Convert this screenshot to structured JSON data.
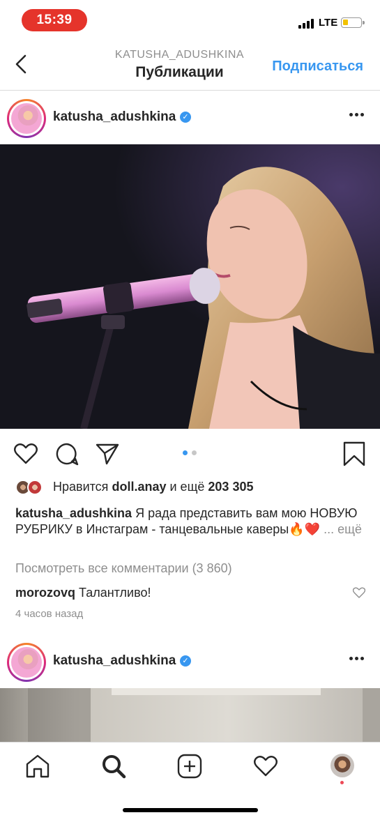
{
  "status_bar": {
    "time": "15:39",
    "network": "LTE",
    "battery_level": 0.3,
    "battery_color": "#f2c200",
    "time_pill_color": "#e5342b"
  },
  "nav": {
    "back_icon": "chevron-left-icon",
    "subtitle": "KATUSHA_ADUSHKINA",
    "title": "Публикации",
    "follow_label": "Подписаться",
    "accent_color": "#3897f0"
  },
  "post": {
    "username": "katusha_adushkina",
    "verified": true,
    "more_icon": "more-horizontal-icon",
    "photo_alt": "",
    "carousel_pages": 2,
    "carousel_active": 1,
    "actions": [
      "heart-icon",
      "comment-icon",
      "share-icon",
      "bookmark-icon"
    ],
    "likes": {
      "prefix": "Нравится",
      "user": "doll.anay",
      "middle": "и ещё",
      "count": "203 305"
    },
    "caption": {
      "user": "katusha_adushkina",
      "text": "Я рада представить вам мою НОВУЮ РУБРИКУ в Инстаграм - танцевальные каверы🔥❤️",
      "more": "... ещё"
    },
    "view_comments": "Посмотреть все комментарии (3 860)",
    "comment": {
      "user": "morozovq",
      "text": "Талантливо!"
    },
    "time_ago": "4 часов назад"
  },
  "next_post": {
    "username": "katusha_adushkina",
    "verified": true
  },
  "tabbar": {
    "tabs": [
      "home-icon",
      "search-icon",
      "add-post-icon",
      "activity-heart-icon",
      "profile-avatar"
    ],
    "active": "search-icon",
    "notification_dot_color": "#ed4956"
  }
}
